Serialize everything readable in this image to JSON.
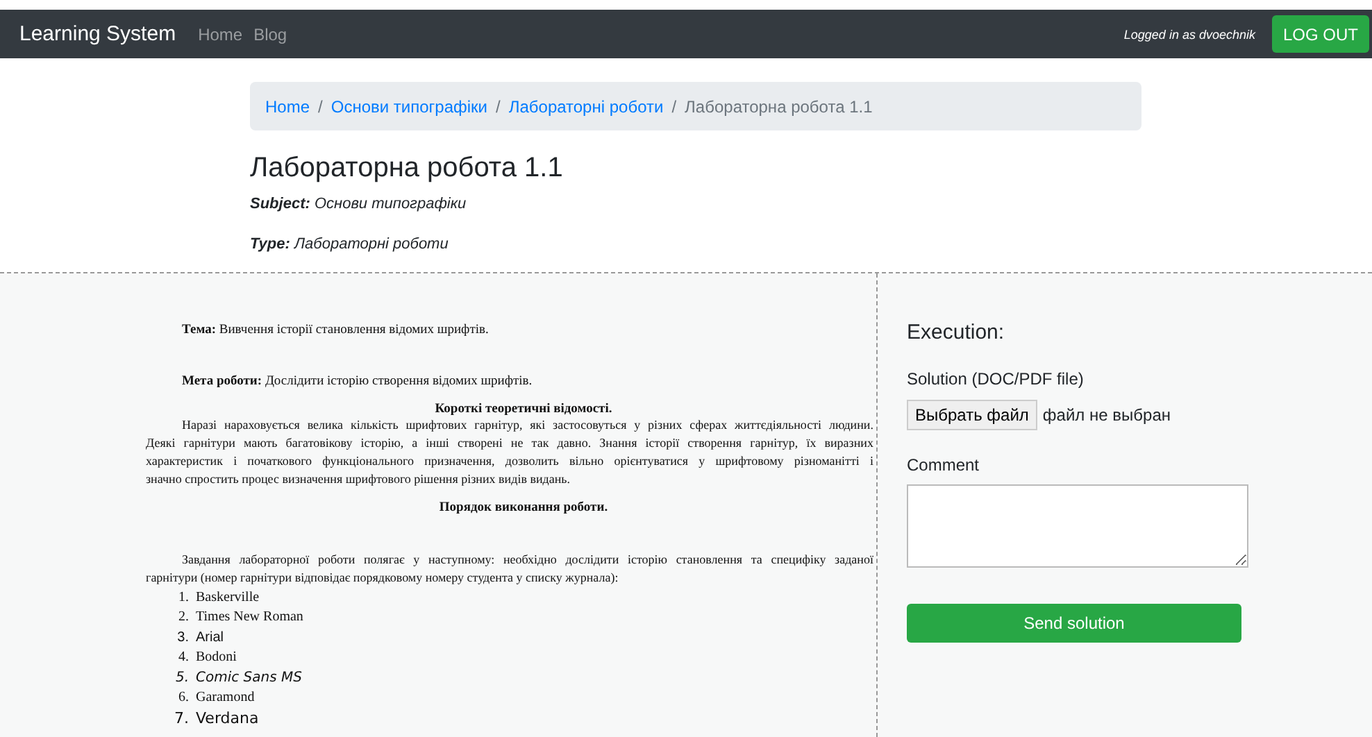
{
  "navbar": {
    "brand": "Learning System",
    "links": [
      {
        "label": "Home"
      },
      {
        "label": "Blog"
      }
    ],
    "user": "Logged in as dvoechnik",
    "logout": "LOG OUT"
  },
  "breadcrumb": [
    {
      "label": "Home",
      "kind": "link"
    },
    {
      "separator": "/",
      "label": "Основи типографіки",
      "kind": "link"
    },
    {
      "separator": "/",
      "label": "Лабораторні роботи",
      "kind": "link"
    },
    {
      "separator": "/",
      "label": "Лабораторна робота 1.1",
      "kind": "current"
    }
  ],
  "title": "Лабораторна робота 1.1",
  "subject": "**Subject:** Основи типографіки",
  "type": "**Type:** Лабораторні роботи",
  "document": {
    "theme": "**Тема:** Вивчення історії становлення відомих шрифтів.",
    "goal": "**Мета роботи:** Дослідити історію створення відомих шрифтів.",
    "theory_heading": "Короткі теоретичні відомості.",
    "theory_lines": [
      "Наразі нараховується велика кількість шрифтових гарнітур, які застосовуться у різних сферах життєдіяльності людини.",
      "Деякі гарнітури мають багатовікову історію, а інші створені не так давно. Знання історії створення гарнітур, їх виразних",
      "характеристик і початкового функціонального призначення, дозволить вільно орієнтуватися у шрифтовому різноманітті і",
      "значно спростить процес визначення шрифтового рішення різних видів видань."
    ],
    "procedure_heading": "Порядок виконання роботи.",
    "task_lines": [
      "Завдання лабораторної роботи полягає у наступному: необхідно дослідити історію становлення та специфіку заданої",
      "гарнітури (номер гарнітури відповідає порядковому номеру студента у списку журнала):"
    ],
    "fonts": [
      {
        "number": "1.",
        "name": "Baskerville",
        "kind": "serif"
      },
      {
        "number": "2.",
        "name": "Times New Roman",
        "kind": "serif"
      },
      {
        "number": "3.",
        "name": "Arial",
        "kind": "sans"
      },
      {
        "number": "4.",
        "name": "Bodoni",
        "kind": "serif"
      },
      {
        "number": "5.",
        "name": "Comic Sans MS",
        "kind": "comic"
      },
      {
        "number": "6.",
        "name": "Garamond",
        "kind": "serif"
      },
      {
        "number": "7.",
        "name": "Verdana",
        "kind": "wide"
      }
    ]
  },
  "execution": {
    "heading": "Execution:",
    "solution_label": "Solution (DOC/PDF file)",
    "file_button": "Выбрать файл",
    "file_status": "файл не выбран",
    "comment_label": "Comment",
    "submit": "Send solution"
  }
}
